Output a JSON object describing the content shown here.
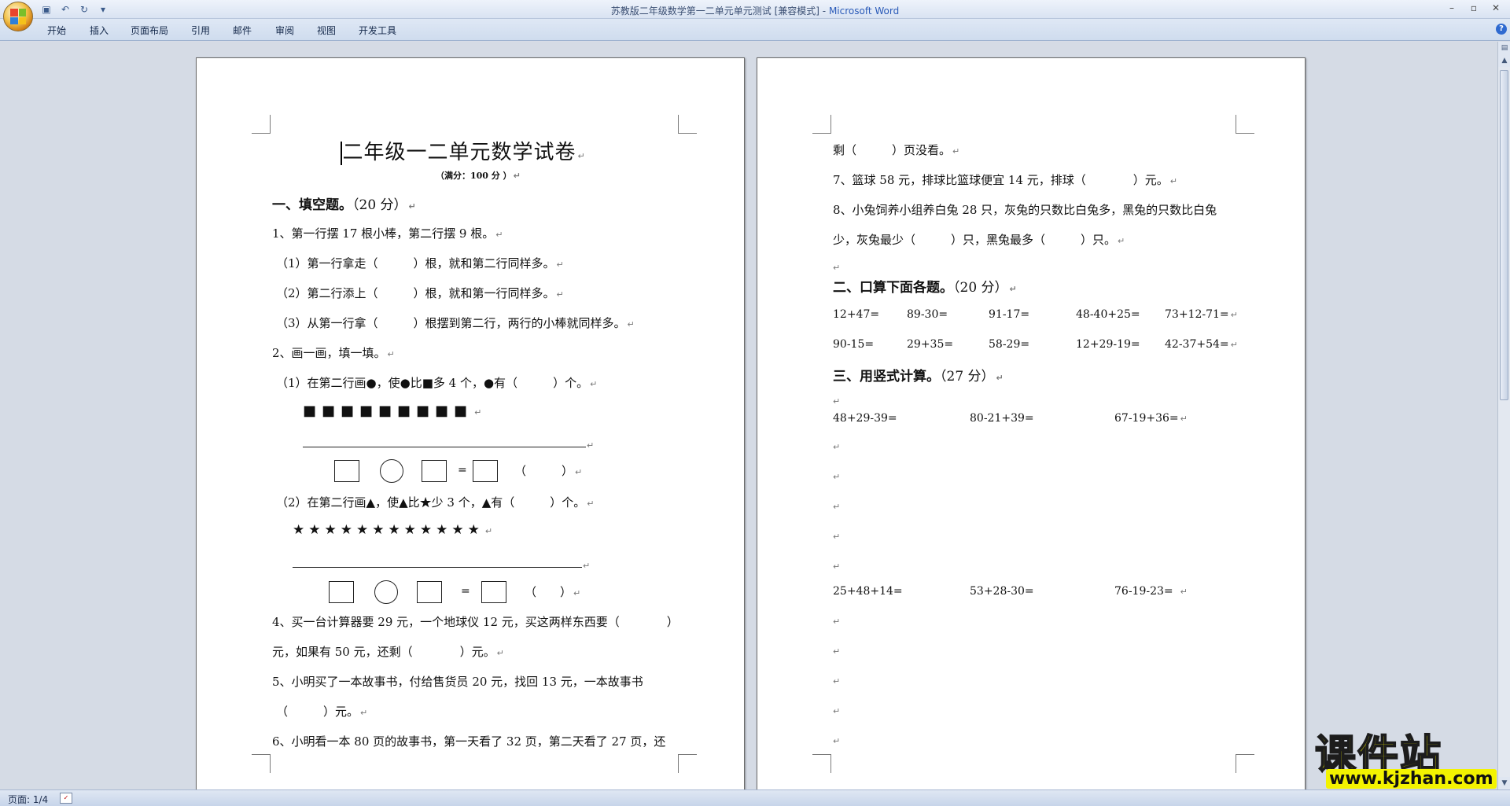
{
  "window": {
    "title": "苏教版二年级数学第一二单元单元测试 [兼容模式]",
    "app_name": "Microsoft Word",
    "separator": " - "
  },
  "quick_access": [
    "save-icon",
    "undo-icon",
    "redo-icon",
    "customize-icon"
  ],
  "ribbon": {
    "tabs": [
      "开始",
      "插入",
      "页面布局",
      "引用",
      "邮件",
      "审阅",
      "视图",
      "开发工具"
    ]
  },
  "page1": {
    "title": "二年级一二单元数学试卷",
    "subtitle": "（满分：100 分 ）",
    "section1": {
      "bold": "一、填空题。",
      "points": "（20 分）"
    },
    "q1": "1、第一行摆 17 根小棒，第二行摆 9 根。",
    "q1_1": "（1）第一行拿走（　　　）根，就和第二行同样多。",
    "q1_2": "（2）第二行添上（　　　）根，就和第一行同样多。",
    "q1_3": "（3）从第一行拿（　　　）根摆到第二行，两行的小棒就同样多。",
    "q2": "2、画一画，填一填。",
    "q2_1": "（1）在第二行画●，使●比■多 4 个，●有（　　　）个。",
    "q2_1_shapes": "■■■■■■■■■",
    "q2_1_eq": "=",
    "q2_1_paren": "（　　　）",
    "q2_2": "（2）在第二行画▲，使▲比★少 3 个，▲有（　　　）个。",
    "q2_2_shapes": "★★★★★★★★★★★★",
    "q2_2_eq": "=",
    "q2_2_paren": "（　　）",
    "q4_a": "4、买一台计算器要 29 元，一个地球仪 12 元，买这两样东西要（　　　　）",
    "q4_b": "元，如果有 50 元，还剩（　　　　）元。",
    "q5_a": "5、小明买了一本故事书，付给售货员  20  元，找回  13  元，一本故事书",
    "q5_b": "（　　　）元。",
    "q6_a": "6、小明看一本 80 页的故事书，第一天看了 32 页，第二天看了 27 页，还"
  },
  "page2": {
    "q6_b": "剩（　　　）页没看。",
    "q7": "7、篮球 58 元，排球比篮球便宜 14 元，排球（　　　　）元。",
    "q8_a": "8、小兔饲养小组养白兔 28 只，灰兔的只数比白兔多，黑兔的只数比白兔",
    "q8_b": "少，灰兔最少（　　　）只，黑兔最多（　　　）只。",
    "section2": {
      "bold": "二、口算下面各题。",
      "points": "（20 分）"
    },
    "mental_row1": [
      "12+47=",
      "89-30=",
      "91-17=",
      "48-40+25=",
      "73+12-71="
    ],
    "mental_row2": [
      "90-15=",
      "29+35=",
      "58-29=",
      "12+29-19=",
      "42-37+54="
    ],
    "section3": {
      "bold": "三、用竖式计算。",
      "points": "（27 分）"
    },
    "vertical_row1": [
      "48+29-39=",
      "80-21+39=",
      "67-19+36="
    ],
    "vertical_row2": [
      "25+48+14=",
      "53+28-30=",
      "76-19-23="
    ]
  },
  "status": {
    "page": "页面: 1/4"
  },
  "watermark": {
    "brand": "课件站",
    "url": "www.kjzhan.com"
  }
}
